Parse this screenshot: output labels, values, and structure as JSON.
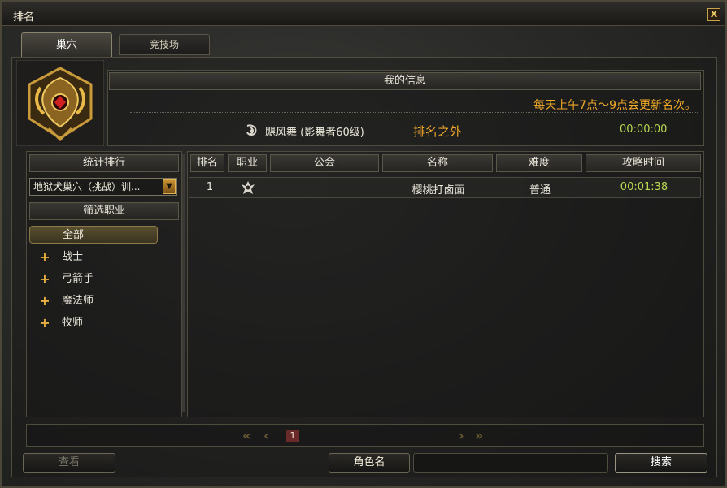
{
  "window": {
    "title": "排名",
    "close_label": "X"
  },
  "tabs": [
    {
      "label": "巢穴",
      "active": true
    },
    {
      "label": "竞技场",
      "active": false
    }
  ],
  "my_info": {
    "header": "我的信息",
    "notice": "每天上午7点～9点会更新名次。",
    "player_name": "飓风舞 (影舞者60级)",
    "rank_text": "排名之外",
    "time": "00:00:00"
  },
  "sidebar": {
    "stat_header": "统计排行",
    "dungeon_select": "地狱犬巢穴（挑战）训...",
    "filter_header": "筛选职业",
    "filters": [
      {
        "label": "全部",
        "selected": true,
        "expandable": false
      },
      {
        "label": "战士",
        "selected": false,
        "expandable": true
      },
      {
        "label": "弓箭手",
        "selected": false,
        "expandable": true
      },
      {
        "label": "魔法师",
        "selected": false,
        "expandable": true
      },
      {
        "label": "牧师",
        "selected": false,
        "expandable": true
      }
    ]
  },
  "table": {
    "columns": [
      "排名",
      "职业",
      "公会",
      "名称",
      "难度",
      "攻略时间"
    ],
    "rows": [
      {
        "rank": "1",
        "job_icon": "shadow-dancer-icon",
        "guild": "",
        "name": "樱桃打卤面",
        "difficulty": "普通",
        "time": "00:01:38"
      }
    ]
  },
  "pager": {
    "current_page": "1"
  },
  "bottom": {
    "view_button": "查看",
    "search_label": "角色名",
    "search_value": "",
    "search_button": "搜索"
  },
  "colors": {
    "accent_orange": "#f0a828",
    "time_green": "#b8d850",
    "border": "#5b5748"
  }
}
